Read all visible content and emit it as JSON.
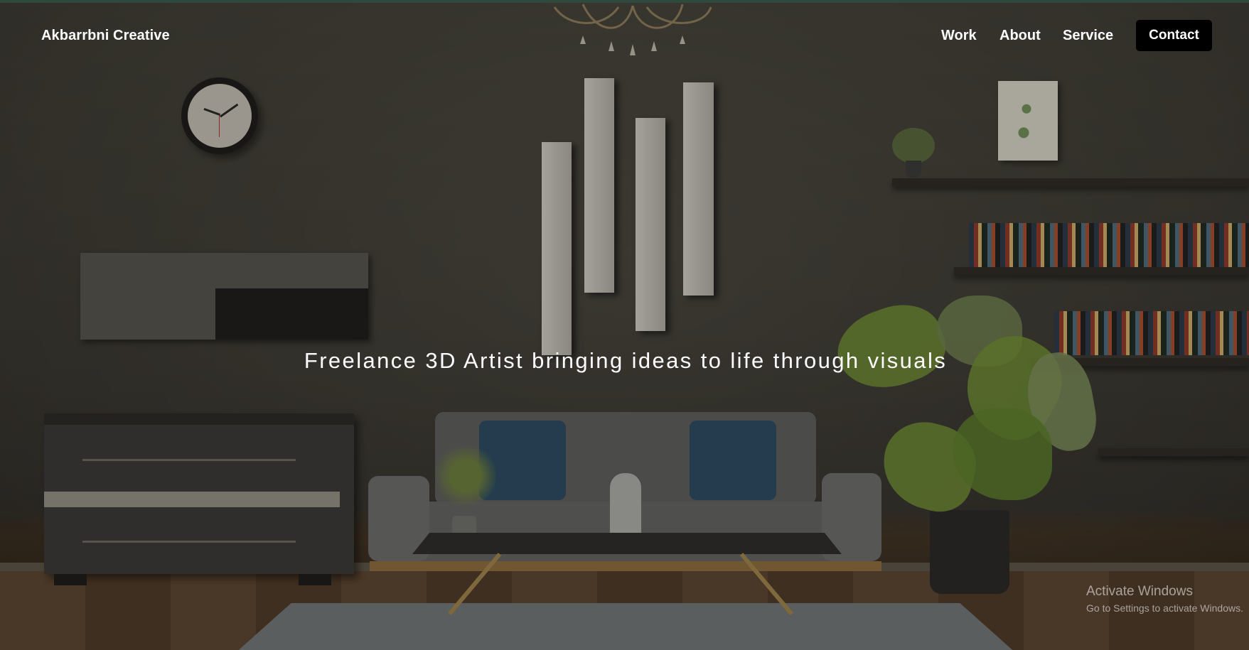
{
  "brand": {
    "name": "Akbarrbni Creative"
  },
  "nav": {
    "items": [
      {
        "label": "Work"
      },
      {
        "label": "About"
      },
      {
        "label": "Service"
      }
    ],
    "contact_label": "Contact"
  },
  "hero": {
    "tagline": "Freelance 3D Artist bringing ideas to life through visuals",
    "background": "living-room-render"
  },
  "watermark": {
    "title": "Activate Windows",
    "subtitle": "Go to Settings to activate Windows."
  },
  "colors": {
    "accent_top_line": "#2f4a3c",
    "contact_button_bg": "#000000",
    "text": "#ffffff"
  }
}
